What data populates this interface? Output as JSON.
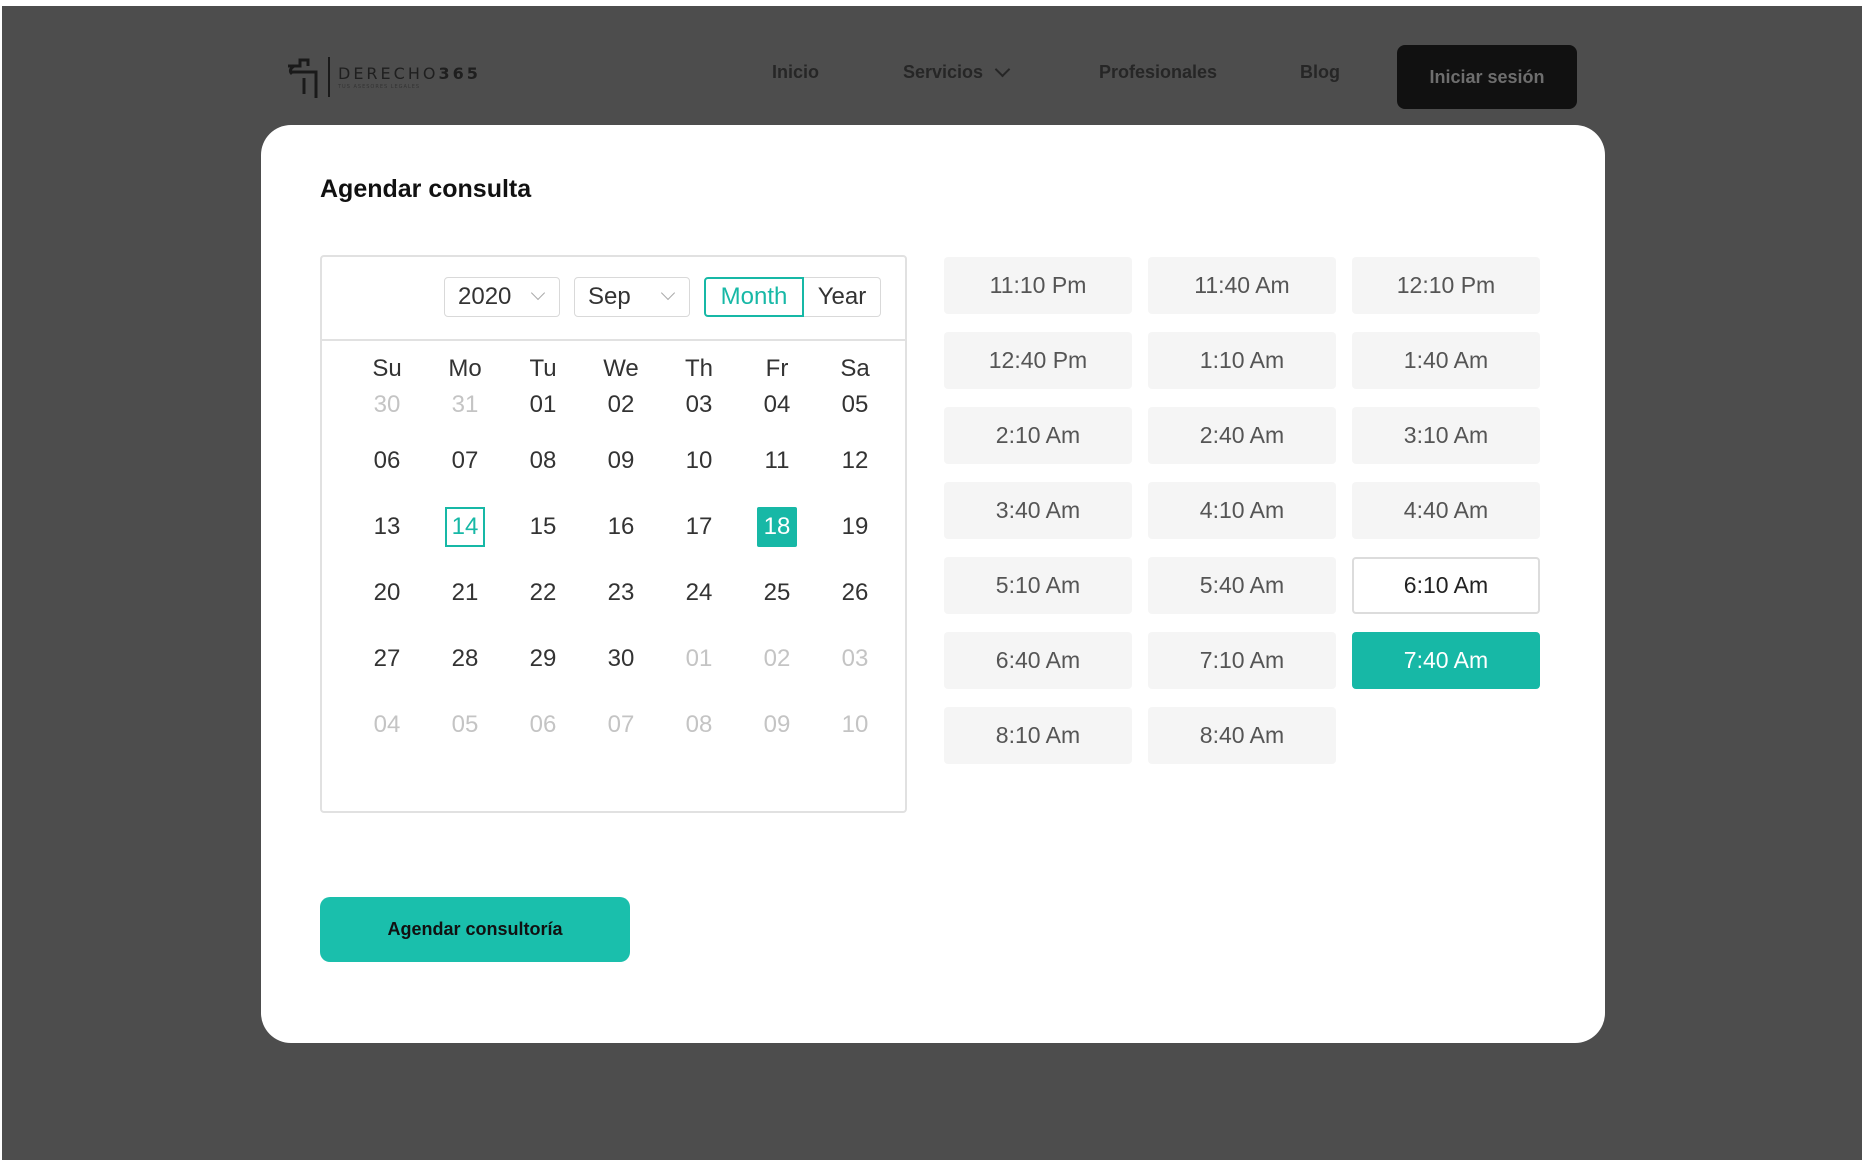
{
  "header": {
    "logo_name_light": "DERECHO",
    "logo_name_bold": "365",
    "logo_tagline": "TUS ASESORES LEGALES",
    "nav": [
      "Inicio",
      "Servicios",
      "Profesionales",
      "Blog"
    ],
    "login_label": "Iniciar sesión"
  },
  "modal": {
    "title": "Agendar consulta",
    "submit_label": "Agendar consultoría"
  },
  "calendar": {
    "year": "2020",
    "month": "Sep",
    "mode_month": "Month",
    "mode_year": "Year",
    "active_mode": "Month",
    "weekdays": [
      "Su",
      "Mo",
      "Tu",
      "We",
      "Th",
      "Fr",
      "Sa"
    ],
    "weeks": [
      [
        "30",
        "31",
        "01",
        "02",
        "03",
        "04",
        "05"
      ],
      [
        "06",
        "07",
        "08",
        "09",
        "10",
        "11",
        "12"
      ],
      [
        "13",
        "14",
        "15",
        "16",
        "17",
        "18",
        "19"
      ],
      [
        "20",
        "21",
        "22",
        "23",
        "24",
        "25",
        "26"
      ],
      [
        "27",
        "28",
        "29",
        "30",
        "01",
        "02",
        "03"
      ],
      [
        "04",
        "05",
        "06",
        "07",
        "08",
        "09",
        "10"
      ]
    ],
    "today": "14",
    "selected": "18"
  },
  "time_slots": [
    "11:10 Pm",
    "11:40 Am",
    "12:10 Pm",
    "12:40 Pm",
    "1:10 Am",
    "1:40 Am",
    "2:10 Am",
    "2:40 Am",
    "3:10 Am",
    "3:40 Am",
    "4:10 Am",
    "4:40 Am",
    "5:10 Am",
    "5:40 Am",
    "6:10 Am",
    "6:40 Am",
    "7:10 Am",
    "7:40 Am",
    "8:10 Am",
    "8:40 Am"
  ],
  "hovered_slot": "6:10 Am",
  "selected_slot": "7:40 Am",
  "colors": {
    "accent": "#17b8a6",
    "overlay": "#4d4d4d"
  }
}
